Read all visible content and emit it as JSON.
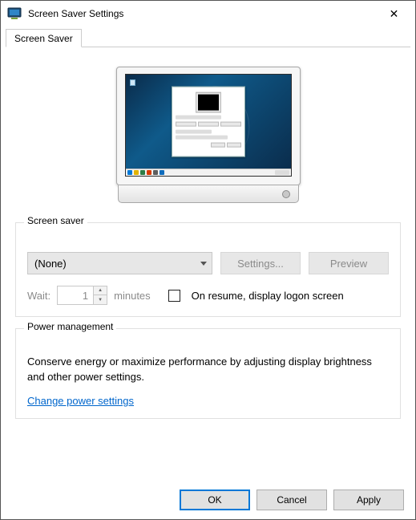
{
  "window": {
    "title": "Screen Saver Settings",
    "close_glyph": "✕"
  },
  "tab": {
    "label": "Screen Saver"
  },
  "screensaver": {
    "group_label": "Screen saver",
    "selected": "(None)",
    "settings_btn": "Settings...",
    "preview_btn": "Preview",
    "wait_label": "Wait:",
    "wait_value": "1",
    "minutes_label": "minutes",
    "resume_label": "On resume, display logon screen"
  },
  "power": {
    "group_label": "Power management",
    "text": "Conserve energy or maximize performance by adjusting display brightness and other power settings.",
    "link": "Change power settings"
  },
  "buttons": {
    "ok": "OK",
    "cancel": "Cancel",
    "apply": "Apply"
  },
  "spinner_glyphs": {
    "up": "▲",
    "down": "▼"
  }
}
